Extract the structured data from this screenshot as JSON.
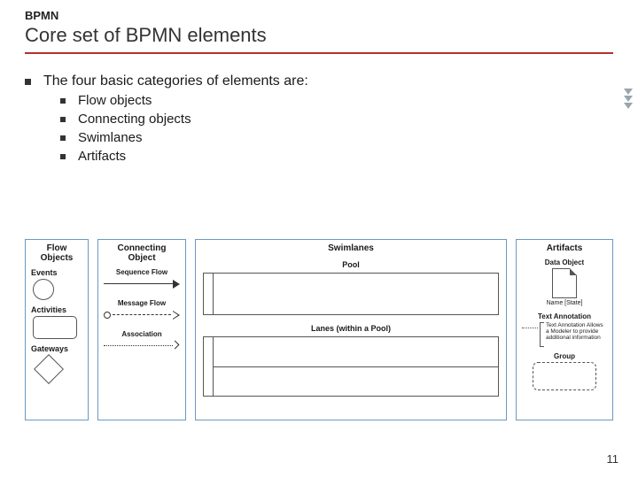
{
  "header": {
    "kicker": "BPMN",
    "title": "Core set of BPMN elements"
  },
  "main_bullet": "The four basic categories of elements are:",
  "sub_bullets": [
    "Flow objects",
    "Connecting objects",
    "Swimlanes",
    "Artifacts"
  ],
  "panels": {
    "flow": {
      "title": "Flow Objects",
      "events": "Events",
      "activities": "Activities",
      "gateways": "Gateways"
    },
    "connecting": {
      "title": "Connecting Object",
      "seq": "Sequence Flow",
      "msg": "Message Flow",
      "assoc": "Association"
    },
    "swimlanes": {
      "title": "Swimlanes",
      "pool": "Pool",
      "lanes": "Lanes (within a Pool)"
    },
    "artifacts": {
      "title": "Artifacts",
      "data": "Data Object",
      "data_caption": "Name [State]",
      "annot": "Text Annotation",
      "annot_text": "Text Annotation Allows a Modeler to provide additional information",
      "group": "Group"
    }
  },
  "page_number": "11"
}
